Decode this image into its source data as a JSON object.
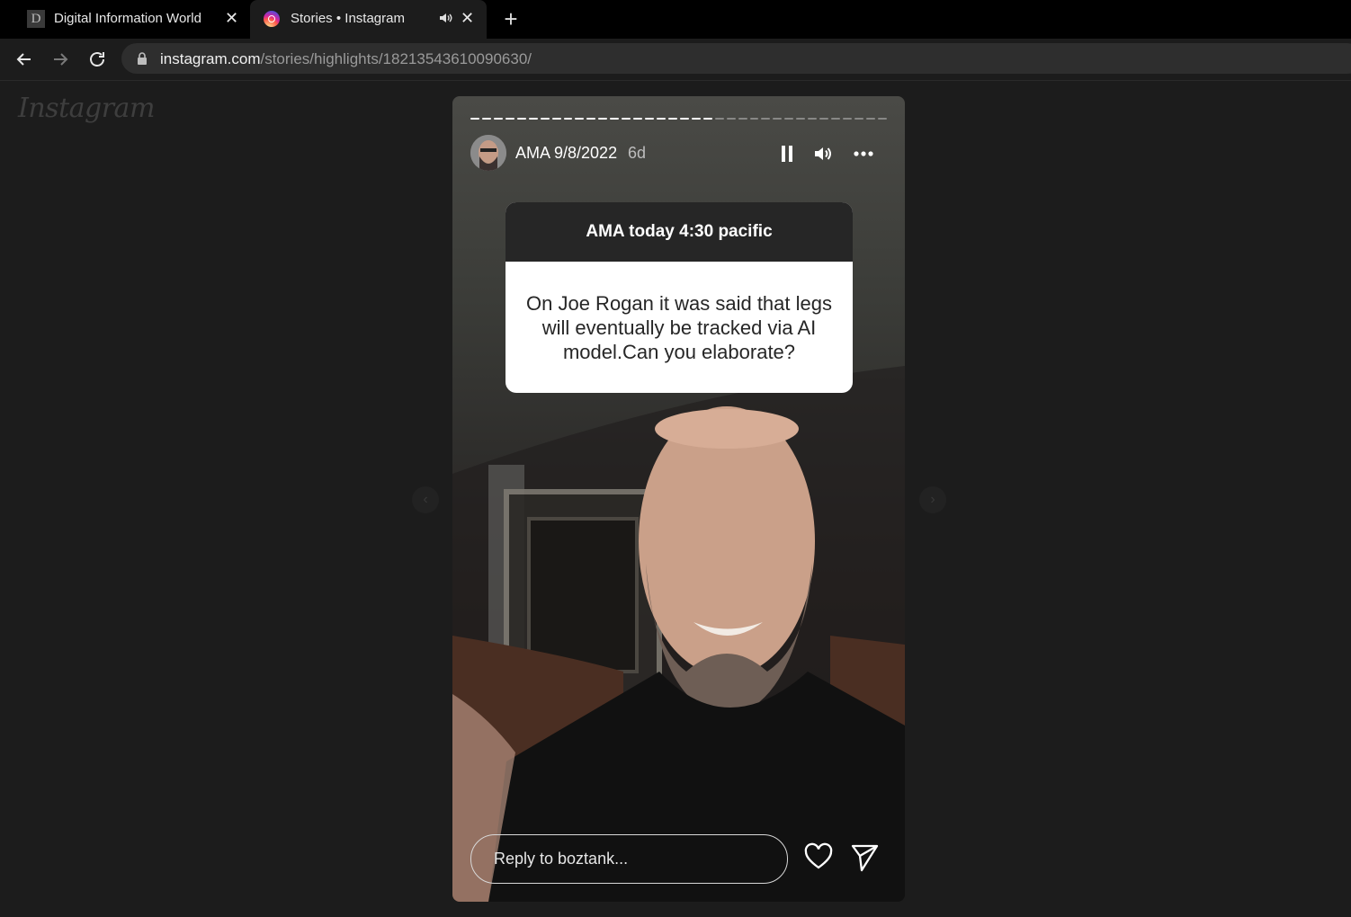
{
  "browser": {
    "tabs": [
      {
        "favicon": "D",
        "title": "Digital Information World",
        "active": false
      },
      {
        "title": "Stories • Instagram",
        "active": true,
        "audio": true
      }
    ],
    "address": {
      "host": "instagram.com",
      "path": "/stories/highlights/18213543610090630/"
    }
  },
  "page": {
    "logo": "Instagram",
    "story": {
      "title": "AMA 9/8/2022",
      "age": "6d",
      "segments_total": 36,
      "segments_viewed": 21,
      "question_card": {
        "header": "AMA today 4:30 pacific",
        "question": "On Joe Rogan it was said that legs will eventually be tracked via AI model.Can you elaborate?"
      },
      "reply_placeholder": "Reply to boztank..."
    }
  },
  "icons": [
    "back-arrow-icon",
    "forward-arrow-icon",
    "reload-icon",
    "lock-icon",
    "pause-icon",
    "volume-icon",
    "more-icon",
    "heart-icon",
    "send-icon",
    "close-icon",
    "plus-icon",
    "speaker-icon"
  ],
  "colors": {
    "page_bg": "#1c1c1c",
    "tabbar_bg": "#000000",
    "omnibox_bg": "#2e2e2e",
    "card_header": "#262626"
  }
}
